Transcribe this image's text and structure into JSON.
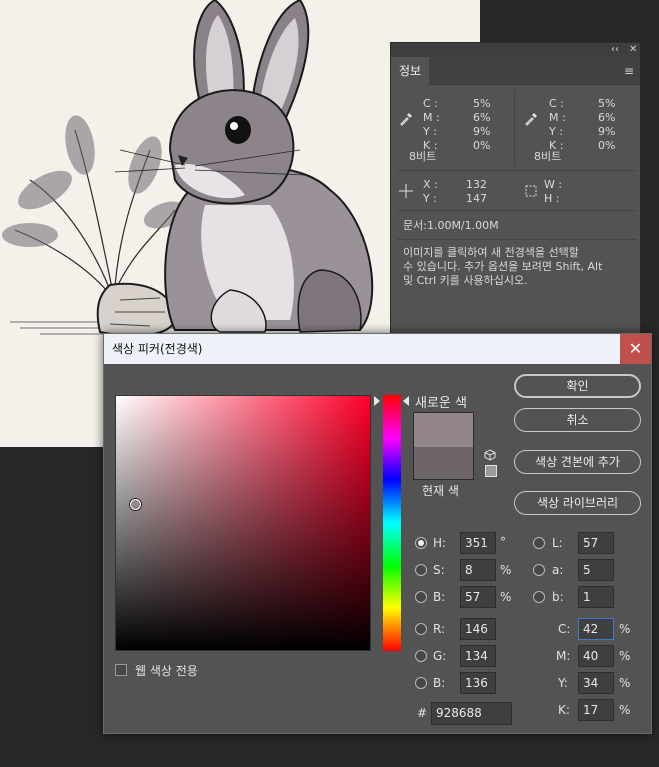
{
  "info_panel": {
    "collapse_glyph": "‹‹",
    "close_glyph": "✕",
    "tab_label": "정보",
    "menu_glyph": "≡",
    "readout_left": {
      "labels": [
        "C :",
        "M :",
        "Y :",
        "K :"
      ],
      "values": [
        "5%",
        "6%",
        "9%",
        "0%"
      ],
      "bits": "8비트"
    },
    "readout_right": {
      "labels": [
        "C :",
        "M :",
        "Y :",
        "K :"
      ],
      "values": [
        "5%",
        "6%",
        "9%",
        "0%"
      ],
      "bits": "8비트"
    },
    "position": {
      "x_label": "X :",
      "x_value": "132",
      "y_label": "Y :",
      "y_value": "147"
    },
    "size": {
      "w_label": "W :",
      "w_value": "",
      "h_label": "H :",
      "h_value": ""
    },
    "doc_info": "문서:1.00M/1.00M",
    "hint_lines": [
      "이미지를 클릭하여 새 전경색을 선택할",
      "수 있습니다. 추가 옵션을 보려면 Shift, Alt",
      "및 Ctrl 키를 사용하십시오."
    ]
  },
  "picker": {
    "title": "색상 피커(전경색)",
    "close_glyph": "✕",
    "new_color_label": "새로운 색",
    "current_color_label": "현재 색",
    "new_color": "#928688",
    "current_color": "#6e6567",
    "buttons": {
      "ok": "확인",
      "cancel": "취소",
      "add_swatch": "색상 견본에 추가",
      "libraries": "색상 라이브러리"
    },
    "hsb": {
      "h_label": "H:",
      "h_value": "351",
      "h_unit": "°",
      "s_label": "S:",
      "s_value": "8",
      "s_unit": "%",
      "b_label": "B:",
      "b_value": "57",
      "b_unit": "%"
    },
    "lab": {
      "l_label": "L:",
      "l_value": "57",
      "a_label": "a:",
      "a_value": "5",
      "b_label": "b:",
      "b_value": "1"
    },
    "rgb": {
      "r_label": "R:",
      "r_value": "146",
      "g_label": "G:",
      "g_value": "134",
      "b_label": "B:",
      "b_value": "136"
    },
    "cmyk": {
      "c_label": "C:",
      "c_value": "42",
      "m_label": "M:",
      "m_value": "40",
      "y_label": "Y:",
      "y_value": "34",
      "k_label": "K:",
      "k_value": "17",
      "unit": "%"
    },
    "hex_label": "#",
    "hex_value": "928688",
    "web_only_label": "웹 색상 전용",
    "hue_color": "#ff002a"
  }
}
